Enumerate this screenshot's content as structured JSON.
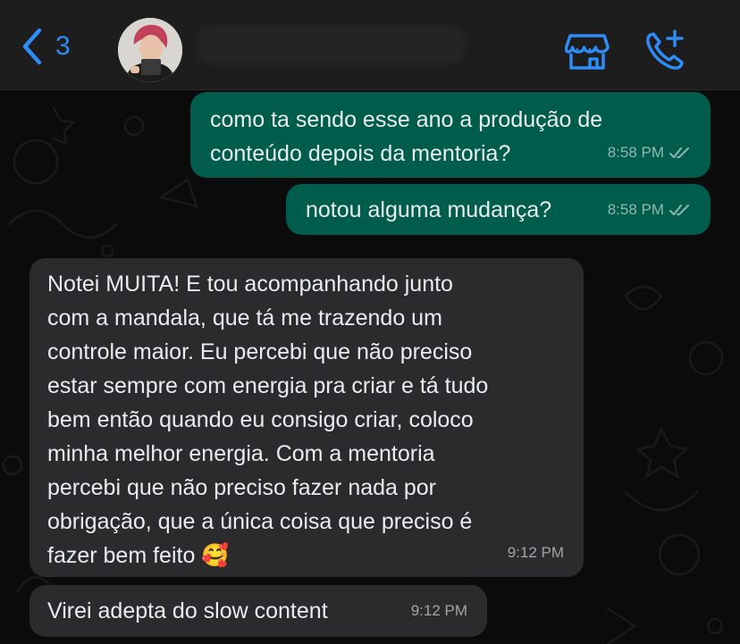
{
  "header": {
    "back_count": "3"
  },
  "messages": [
    {
      "direction": "outgoing",
      "lines": [
        "como ta sendo esse ano a produção de",
        "conteúdo depois da mentoria?"
      ],
      "time": "8:58 PM"
    },
    {
      "direction": "outgoing",
      "lines": [
        "notou alguma mudança?"
      ],
      "time": "8:58 PM"
    },
    {
      "direction": "incoming",
      "lines": [
        "Notei MUITA! E tou acompanhando junto",
        "com a mandala, que tá me trazendo um",
        "controle maior. Eu percebi que não preciso",
        "estar sempre com energia pra criar e tá tudo",
        "bem então quando eu consigo criar, coloco",
        "minha melhor energia. Com a mentoria",
        "percebi que não preciso fazer nada por",
        "obrigação, que a única coisa que preciso é",
        "fazer bem feito 🥰"
      ],
      "time": "9:12 PM"
    },
    {
      "direction": "incoming",
      "lines": [
        "Virei adepta do slow content"
      ],
      "time": "9:12 PM"
    }
  ],
  "colors": {
    "accent": "#2f8cf6",
    "outgoing_bubble": "#005c4b",
    "incoming_bubble": "#2b2b2d",
    "background": "#0b0b0b"
  },
  "icons": [
    "chevron-left-icon",
    "store-icon",
    "phone-add-icon",
    "double-check-icon"
  ]
}
